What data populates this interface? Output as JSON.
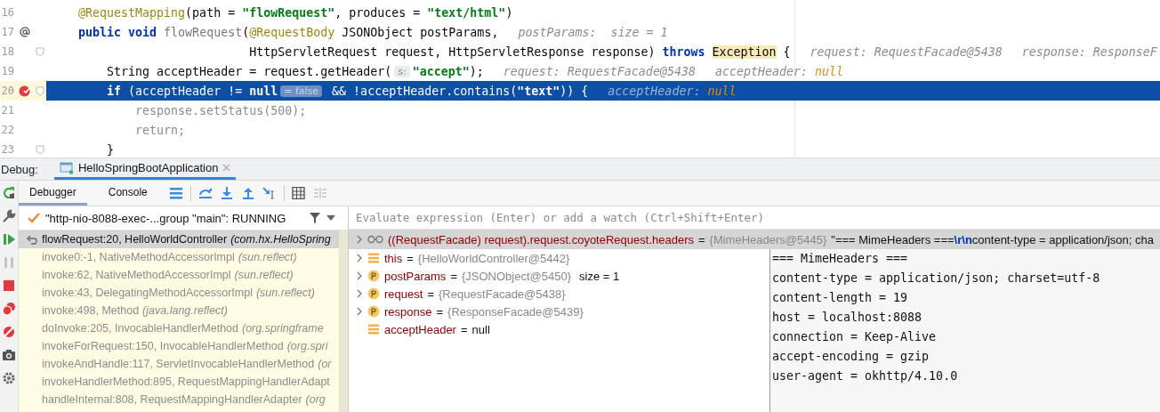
{
  "editor": {
    "lines": [
      {
        "number": "16",
        "annotation_marker": false,
        "breakpoint": false,
        "fold_marker": false,
        "selected": false,
        "tokens": [
          {
            "kind": "annotation",
            "text": "    @RequestMapping"
          },
          {
            "kind": "plain",
            "text": "(path = "
          },
          {
            "kind": "string",
            "text": "\"flowRequest\""
          },
          {
            "kind": "plain",
            "text": ", produces = "
          },
          {
            "kind": "string",
            "text": "\"text/html\""
          },
          {
            "kind": "plain",
            "text": ")"
          }
        ]
      },
      {
        "number": "17",
        "annotation_marker": true,
        "breakpoint": false,
        "fold_marker": false,
        "selected": false,
        "tokens": [
          {
            "kind": "keyword",
            "text": "    public void"
          },
          {
            "kind": "method",
            "text": " flowRequest"
          },
          {
            "kind": "plain",
            "text": "("
          },
          {
            "kind": "annotation",
            "text": "@RequestBody"
          },
          {
            "kind": "plain",
            "text": " JSONObject postParams,"
          },
          {
            "kind": "hint",
            "text": "postParams:  size = 1"
          }
        ]
      },
      {
        "number": "18",
        "annotation_marker": false,
        "breakpoint": false,
        "fold_marker": true,
        "selected": false,
        "tokens": [
          {
            "kind": "plain",
            "text": "                            HttpServletRequest request, HttpServletResponse response) "
          },
          {
            "kind": "keyword",
            "text": "throws "
          },
          {
            "kind": "highlight",
            "text": "Exception"
          },
          {
            "kind": "plain",
            "text": " {"
          },
          {
            "kind": "hint",
            "text": "request: RequestFacade@5438"
          },
          {
            "kind": "hint",
            "text": "response: ResponseF"
          }
        ]
      },
      {
        "number": "19",
        "annotation_marker": false,
        "breakpoint": false,
        "fold_marker": false,
        "selected": false,
        "tokens": [
          {
            "kind": "plain",
            "text": "        String acceptHeader = request.getHeader("
          },
          {
            "kind": "chip",
            "text": "s:"
          },
          {
            "kind": "string",
            "text": "\"accept\""
          },
          {
            "kind": "plain",
            "text": ");"
          },
          {
            "kind": "hint",
            "text": "request: RequestFacade@5438"
          },
          {
            "kind": "hint",
            "text": "acceptHeader:"
          },
          {
            "kind": "hint-null",
            "text": "null"
          }
        ]
      },
      {
        "number": "20",
        "annotation_marker": false,
        "breakpoint": true,
        "fold_marker": true,
        "selected": true,
        "tokens": [
          {
            "kind": "keyword",
            "text": "        if"
          },
          {
            "kind": "plain",
            "text": " (acceptHeader != "
          },
          {
            "kind": "keyword",
            "text": "null"
          },
          {
            "kind": "chip",
            "text": "= false"
          },
          {
            "kind": "plain",
            "text": " && !acceptHeader.contains("
          },
          {
            "kind": "string",
            "text": "\"text\""
          },
          {
            "kind": "plain",
            "text": ")) {"
          },
          {
            "kind": "hint",
            "text": "acceptHeader:"
          },
          {
            "kind": "hint-null",
            "text": "null"
          }
        ]
      },
      {
        "number": "21",
        "annotation_marker": false,
        "breakpoint": false,
        "fold_marker": false,
        "selected": false,
        "tokens": [
          {
            "kind": "dim",
            "text": "            response.setStatus(500);"
          }
        ]
      },
      {
        "number": "22",
        "annotation_marker": false,
        "breakpoint": false,
        "fold_marker": false,
        "selected": false,
        "tokens": [
          {
            "kind": "dim",
            "text": "            return;"
          }
        ]
      },
      {
        "number": "23",
        "annotation_marker": false,
        "breakpoint": false,
        "fold_marker": true,
        "selected": false,
        "tokens": [
          {
            "kind": "plain",
            "text": "        }"
          }
        ]
      }
    ]
  },
  "debug": {
    "label": "Debug:",
    "session_tab": {
      "label": "HelloSpringBootApplication",
      "selected": true
    },
    "tabs": [
      {
        "label": "Debugger",
        "selected": true
      },
      {
        "label": "Console",
        "selected": false
      }
    ],
    "thread": "\"http-nio-8088-exec-...group \"main\": RUNNING",
    "frames": [
      {
        "method": "flowRequest:20, HelloWorldController",
        "package": "(com.hx.HelloSpring",
        "selected": true,
        "library": false
      },
      {
        "method": "invoke0:-1, NativeMethodAccessorImpl",
        "package": "(sun.reflect)",
        "selected": false,
        "library": true
      },
      {
        "method": "invoke:62, NativeMethodAccessorImpl",
        "package": "(sun.reflect)",
        "selected": false,
        "library": true
      },
      {
        "method": "invoke:43, DelegatingMethodAccessorImpl",
        "package": "(sun.reflect)",
        "selected": false,
        "library": true
      },
      {
        "method": "invoke:498, Method",
        "package": "(java.lang.reflect)",
        "selected": false,
        "library": true
      },
      {
        "method": "doInvoke:205, InvocableHandlerMethod",
        "package": "(org.springframe",
        "selected": false,
        "library": true
      },
      {
        "method": "invokeForRequest:150, InvocableHandlerMethod",
        "package": "(org.spri",
        "selected": false,
        "library": true
      },
      {
        "method": "invokeAndHandle:117, ServletInvocableHandlerMethod",
        "package": "(or",
        "selected": false,
        "library": true
      },
      {
        "method": "invokeHandlerMethod:895, RequestMappingHandlerAdapt",
        "selected": false,
        "library": true
      },
      {
        "method": "handleInternal:808, RequestMappingHandlerAdapter",
        "package": "(org",
        "selected": false,
        "library": true
      }
    ],
    "evaluate": {
      "placeholder": "Evaluate expression (Enter) or add a watch (Ctrl+Shift+Enter)"
    },
    "watch": {
      "expression": "((RequestFacade) request).request.coyoteRequest.headers",
      "operator": "=",
      "type": "{MimeHeaders@5445}",
      "selected": true,
      "value_parts": [
        {
          "kind": "text",
          "text": "\"=== MimeHeaders ==="
        },
        {
          "kind": "escape",
          "text": "\\r\\n"
        },
        {
          "kind": "text",
          "text": "content-type = application/json; cha"
        }
      ]
    },
    "variables": [
      {
        "kind": "field",
        "name": "this",
        "operator": "=",
        "value": "{HelloWorldController@5442}",
        "value_dim": true,
        "expandable": true
      },
      {
        "kind": "param",
        "name": "postParams",
        "operator": "=",
        "value": "{JSONObject@5450}",
        "value_dim": true,
        "extra": "size = 1",
        "expandable": true
      },
      {
        "kind": "param",
        "name": "request",
        "operator": "=",
        "value": "{RequestFacade@5438}",
        "value_dim": true,
        "expandable": true
      },
      {
        "kind": "param",
        "name": "response",
        "operator": "=",
        "value": "{ResponseFacade@5439}",
        "value_dim": true,
        "expandable": true
      },
      {
        "kind": "field",
        "name": "acceptHeader",
        "operator": "=",
        "value": "null",
        "value_dim": false,
        "expandable": false
      }
    ],
    "tooltip_lines": [
      "=== MimeHeaders ===",
      "content-type = application/json; charset=utf-8",
      "content-length = 19",
      "host = localhost:8088",
      "connection = Keep-Alive",
      "accept-encoding = gzip",
      "user-agent = okhttp/4.10.0"
    ]
  }
}
